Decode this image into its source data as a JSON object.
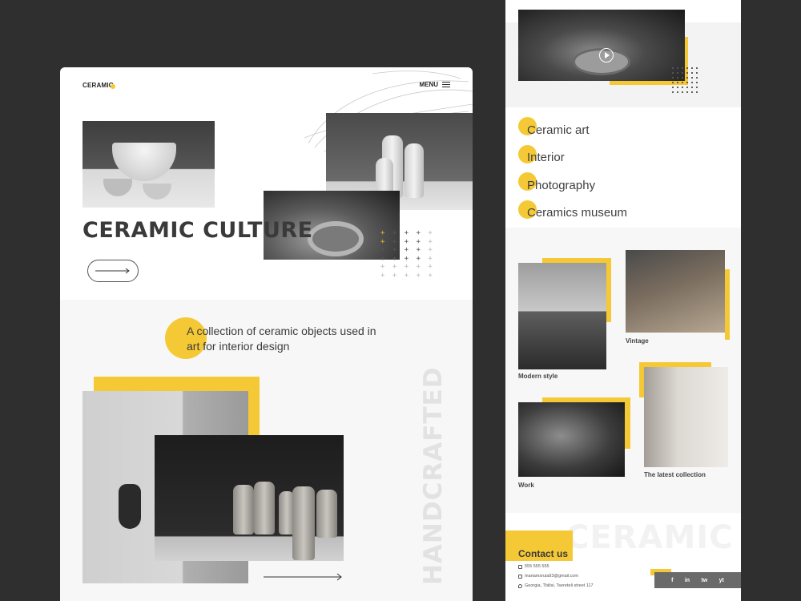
{
  "header": {
    "logo": "CERAMIC",
    "menu_label": "MENU"
  },
  "hero": {
    "title": "CERAMIC CULTURE",
    "plus_rows": [
      "+ + + + +",
      "+ + + + +",
      "+ + + + +",
      "+ + + + +",
      "+ + + + +",
      "+ + + + +"
    ]
  },
  "intro": {
    "text": "A collection of ceramic objects used in art for interior design"
  },
  "vertical_word": "HANDCRAFTED",
  "categories": [
    {
      "label": "Ceramic art"
    },
    {
      "label": "Interior"
    },
    {
      "label": "Photography"
    },
    {
      "label": "Ceramics museum"
    }
  ],
  "gallery": {
    "modern": "Modern style",
    "vintage": "Vintage",
    "work": "Work",
    "latest": "The latest collection"
  },
  "footer": {
    "big_word": "CERAMIC",
    "contact_title": "Contact us",
    "phone": "555 555 555",
    "email": "mariamsruia93@gmail.com",
    "address": "Georgia, Tbilisi, Tsereteli street 117",
    "social": [
      "f",
      "in",
      "tw",
      "yt"
    ]
  },
  "colors": {
    "accent": "#f5c936",
    "background": "#2f2f2f",
    "text": "#3a3a3a"
  }
}
